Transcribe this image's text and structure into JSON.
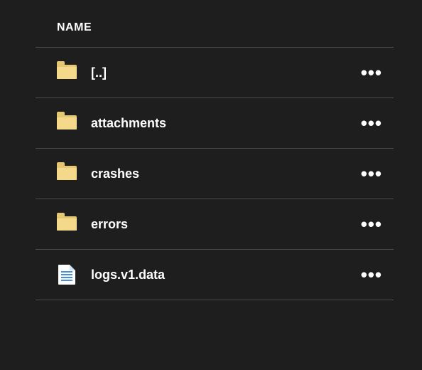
{
  "header": {
    "name_label": "NAME"
  },
  "rows": [
    {
      "type": "folder",
      "name": "[..]"
    },
    {
      "type": "folder",
      "name": "attachments"
    },
    {
      "type": "folder",
      "name": "crashes"
    },
    {
      "type": "folder",
      "name": "errors"
    },
    {
      "type": "file",
      "name": "logs.v1.data"
    }
  ],
  "more_glyph": "•••"
}
